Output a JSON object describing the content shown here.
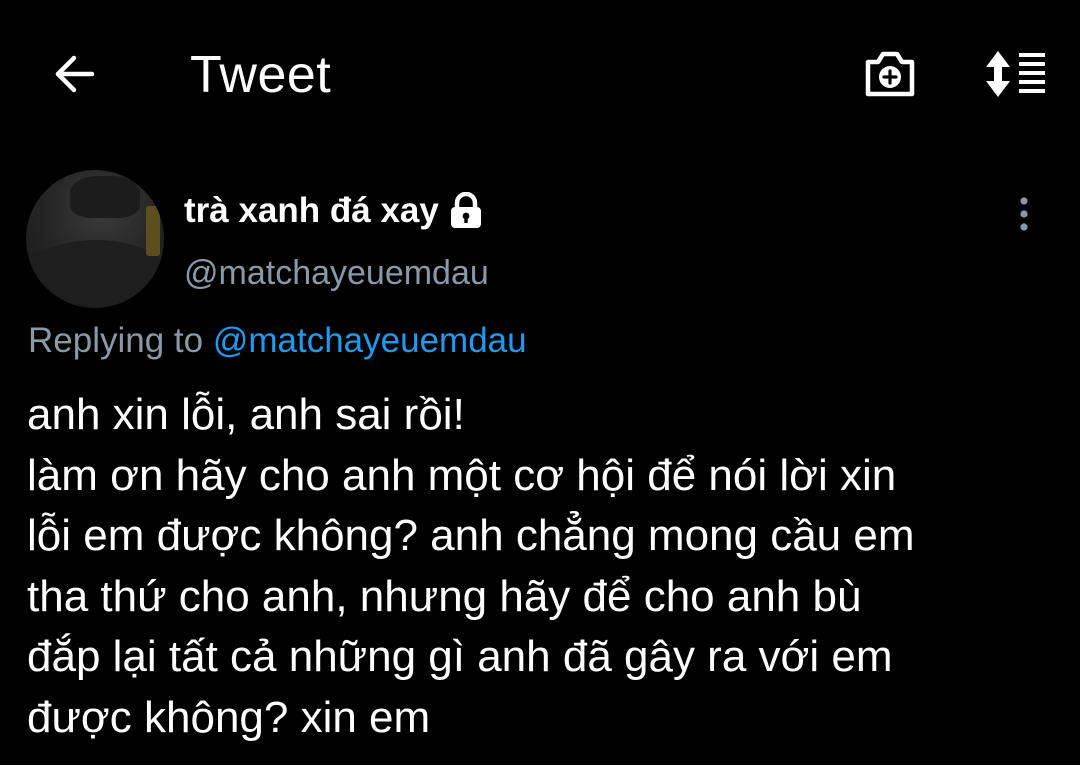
{
  "header": {
    "title": "Tweet",
    "back_icon": "arrow-left-icon",
    "camera_icon": "camera-add-icon",
    "sort_icon": "sort-list-icon"
  },
  "tweet": {
    "author": {
      "display_name": "trà xanh đá xay",
      "handle": "@matchayeuemdau",
      "protected_icon": "lock-icon"
    },
    "reply": {
      "prefix": "Replying to",
      "mention": "@matchayeuemdau"
    },
    "text_lines": [
      "anh xin lỗi, anh sai rồi!",
      "làm ơn hãy cho anh một cơ hội để nói lời xin",
      "lỗi em được không? anh chẳng mong cầu em",
      "tha thứ cho anh, nhưng hãy để cho anh bù",
      "đắp lại tất cả những gì anh đã gây ra với em",
      "được không? xin em"
    ],
    "more_icon": "more-vertical-icon"
  },
  "colors": {
    "background": "#000000",
    "text": "#ffffff",
    "secondary": "#8b98a5",
    "accent": "#1d9bf0"
  }
}
